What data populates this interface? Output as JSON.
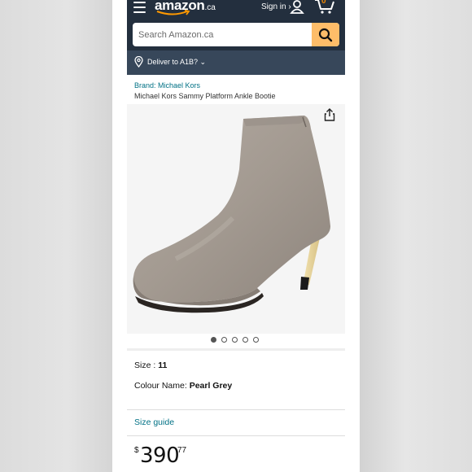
{
  "header": {
    "logo_text": "amazon",
    "logo_tld": ".ca",
    "signin_label": "Sign in ›",
    "cart_count": "0",
    "search_placeholder": "Search Amazon.ca",
    "deliver_label": "Deliver to A1B? ⌄"
  },
  "product": {
    "brand_link": "Brand: Michael Kors",
    "title": "Michael Kors Sammy Platform Ankle Bootie",
    "image_count": 5,
    "active_image": 1,
    "size_label": "Size : ",
    "size_value": "11",
    "colour_label": "Colour Name: ",
    "colour_value": "Pearl Grey",
    "size_guide": "Size guide",
    "price_currency": "$",
    "price_whole": "390",
    "price_fraction": "77"
  },
  "colors": {
    "nav_dark": "#232f3e",
    "nav_secondary": "#37475a",
    "search_button": "#febd69",
    "link": "#007185",
    "cart_accent": "#f08804"
  },
  "icons": [
    "menu-icon",
    "user-icon",
    "cart-icon",
    "search-icon",
    "location-pin-icon",
    "share-icon"
  ]
}
